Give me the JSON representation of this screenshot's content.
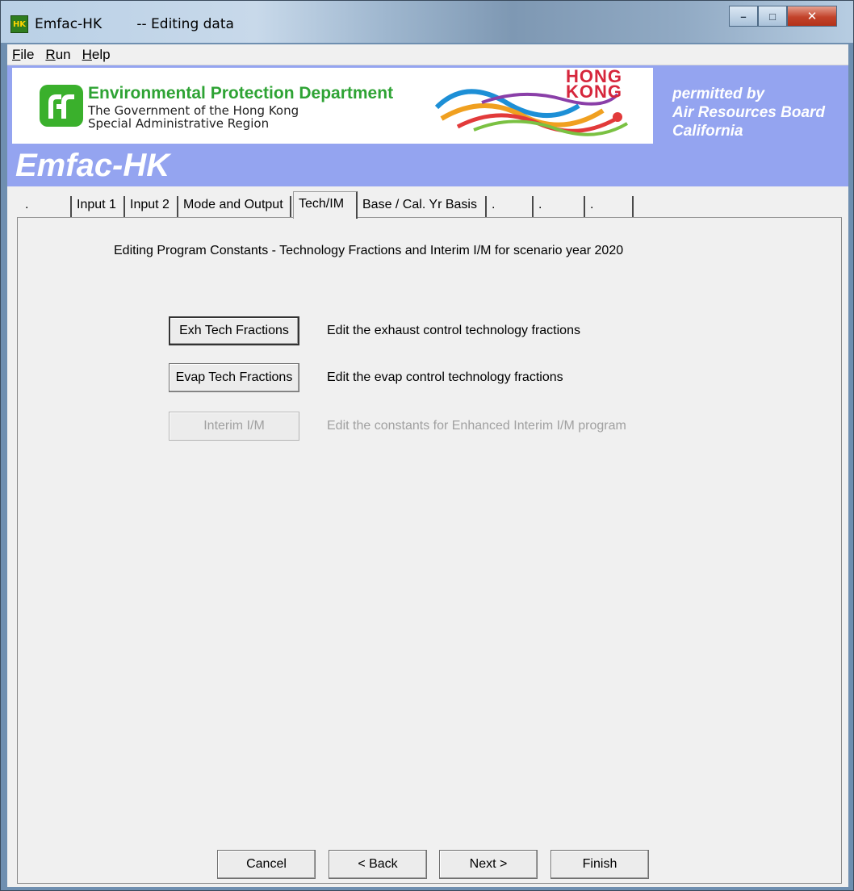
{
  "window": {
    "app_name": "Emfac-HK",
    "subtitle": "-- Editing data",
    "icon": "emfac-app-icon",
    "controls": {
      "minimize": "–",
      "maximize": "□",
      "close": "✕"
    }
  },
  "menu": [
    {
      "label": "File",
      "accel": "F",
      "rest": "ile"
    },
    {
      "label": "Run",
      "accel": "R",
      "rest": "un"
    },
    {
      "label": "Help",
      "accel": "H",
      "rest": "elp"
    }
  ],
  "banner": {
    "epd_title": "Environmental Protection Department",
    "epd_sub1": "The Government of the Hong Kong",
    "epd_sub2": "Special Administrative Region",
    "hk_line1": "HONG",
    "hk_line2": "KONG",
    "permitted_line1": "permitted by",
    "permitted_line2": "Air Resources Board",
    "permitted_line3": "California",
    "app_title": "Emfac-HK",
    "colors": {
      "banner": "#94a4f0",
      "epd_green": "#2ea334",
      "hk_red": "#d6263c"
    }
  },
  "tabs": [
    ".",
    "Input 1",
    "Input 2",
    "Mode and Output",
    "Tech/IM",
    "Base / Cal. Yr Basis",
    ".",
    ".",
    "."
  ],
  "active_tab": "Tech/IM",
  "page": {
    "heading": "Editing Program Constants - Technology Fractions and Interim I/M for scenario year 2020",
    "actions": [
      {
        "button": "Exh Tech Fractions",
        "description": "Edit the exhaust control technology fractions",
        "enabled": true
      },
      {
        "button": "Evap Tech Fractions",
        "description": "Edit the evap control technology fractions",
        "enabled": true
      },
      {
        "button": "Interim I/M",
        "description": "Edit the constants for Enhanced Interim I/M program",
        "enabled": false
      }
    ]
  },
  "footer": {
    "cancel": "Cancel",
    "back": "< Back",
    "next": "Next >",
    "finish": "Finish"
  }
}
